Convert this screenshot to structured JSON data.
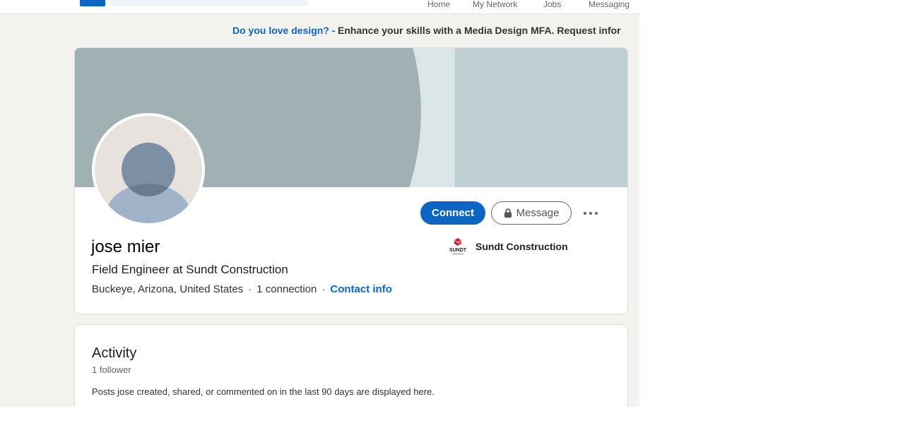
{
  "nav": {
    "items": [
      "Home",
      "My Network",
      "Jobs",
      "Messaging"
    ]
  },
  "ad": {
    "lead": "Do you love design? -",
    "rest": "Enhance your skills with a Media Design MFA. Request infor"
  },
  "profile": {
    "name": "jose mier",
    "headline": "Field Engineer at Sundt Construction",
    "location": "Buckeye, Arizona, United States",
    "connections": "1 connection",
    "contact_info": "Contact info",
    "connect_label": "Connect",
    "message_label": "Message",
    "company": {
      "name": "Sundt Construction",
      "logo_text": "SUNDT"
    }
  },
  "activity": {
    "title": "Activity",
    "followers": "1 follower",
    "description": "Posts jose created, shared, or commented on in the last 90 days are displayed here."
  },
  "colors": {
    "accent": "#0a66c2",
    "page_bg": "#f3f2ef",
    "banner": "#a0b1b4"
  },
  "icons": [
    "linkedin-logo-icon",
    "lock-icon",
    "more-options-icon",
    "default-avatar-icon",
    "sundt-logo-icon"
  ]
}
